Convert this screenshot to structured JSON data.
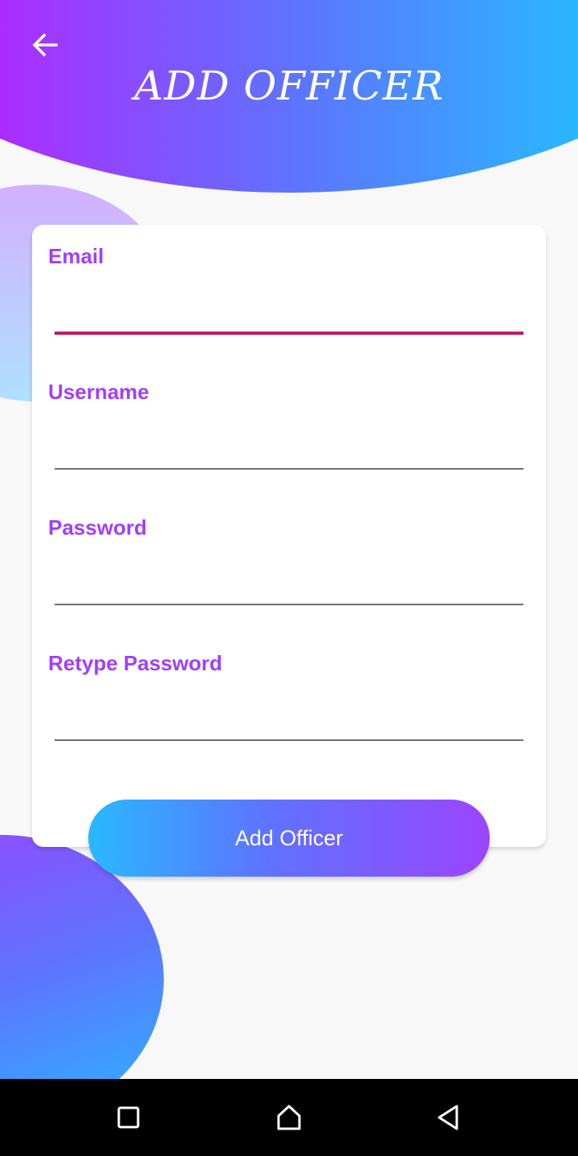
{
  "header": {
    "title": "ADD OFFICER",
    "back_icon": "arrow-left-icon"
  },
  "form": {
    "fields": [
      {
        "label": "Email",
        "value": "",
        "active": true
      },
      {
        "label": "Username",
        "value": "",
        "active": false
      },
      {
        "label": "Password",
        "value": "",
        "active": false
      },
      {
        "label": "Retype Password",
        "value": "",
        "active": false
      }
    ],
    "submit_label": "Add Officer"
  },
  "nav_bar": {
    "icons": [
      "recents-square-icon",
      "home-icon",
      "back-triangle-icon"
    ]
  },
  "colors": {
    "accent": "#a23dff",
    "active_underline": "#c2185b",
    "gradient_purple": "#ad2bff",
    "gradient_blue": "#29b8ff"
  }
}
